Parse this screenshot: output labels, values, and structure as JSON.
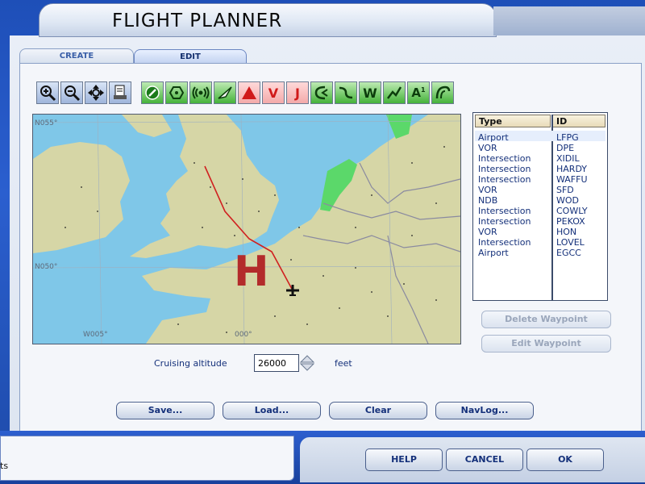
{
  "window": {
    "title": "FLIGHT PLANNER"
  },
  "tabs": [
    {
      "label": "CREATE"
    },
    {
      "label": "EDIT"
    }
  ],
  "toolbar": {
    "icons": [
      "zoom-in",
      "zoom-out",
      "pan",
      "print",
      "airport-filter",
      "vor-filter",
      "ndb-filter",
      "intersection-filter",
      "airways-filter",
      "victor-airways-filter",
      "jet-airways-filter",
      "boundaries-filter",
      "terrain-filter",
      "weather-filter",
      "lat-lon-filter",
      "airspace-filter",
      "wind-filter"
    ],
    "labels": {
      "victor": "V",
      "jet": "J",
      "weather": "W",
      "alt": "A",
      "alt_sup": "1"
    }
  },
  "map": {
    "grid_labels": [
      "N055°",
      "N050°",
      "W005°",
      "000°"
    ],
    "marker": "H"
  },
  "waypoints": {
    "headers": {
      "type": "Type",
      "id": "ID"
    },
    "rows": [
      {
        "type": "Airport",
        "id": "LFPG"
      },
      {
        "type": "VOR",
        "id": "DPE"
      },
      {
        "type": "Intersection",
        "id": "XIDIL"
      },
      {
        "type": "Intersection",
        "id": "HARDY"
      },
      {
        "type": "Intersection",
        "id": "WAFFU"
      },
      {
        "type": "VOR",
        "id": "SFD"
      },
      {
        "type": "NDB",
        "id": "WOD"
      },
      {
        "type": "Intersection",
        "id": "COWLY"
      },
      {
        "type": "Intersection",
        "id": "PEKOX"
      },
      {
        "type": "VOR",
        "id": "HON"
      },
      {
        "type": "Intersection",
        "id": "LOVEL"
      },
      {
        "type": "Airport",
        "id": "EGCC"
      }
    ]
  },
  "side_buttons": {
    "delete": "Delete Waypoint",
    "edit": "Edit Waypoint"
  },
  "altitude": {
    "label": "Cruising altitude",
    "value": "26000",
    "unit": "feet"
  },
  "actions": {
    "save": "Save...",
    "load": "Load...",
    "clear": "Clear",
    "navlog": "NavLog..."
  },
  "footer": {
    "help": "HELP",
    "cancel": "CANCEL",
    "ok": "OK",
    "edge_text": "ts"
  },
  "colors": {
    "sea": "#7fc7e8",
    "land": "#d6d6a6",
    "route": "#d02020",
    "marker": "#b32b2b",
    "link": "#14307a"
  }
}
